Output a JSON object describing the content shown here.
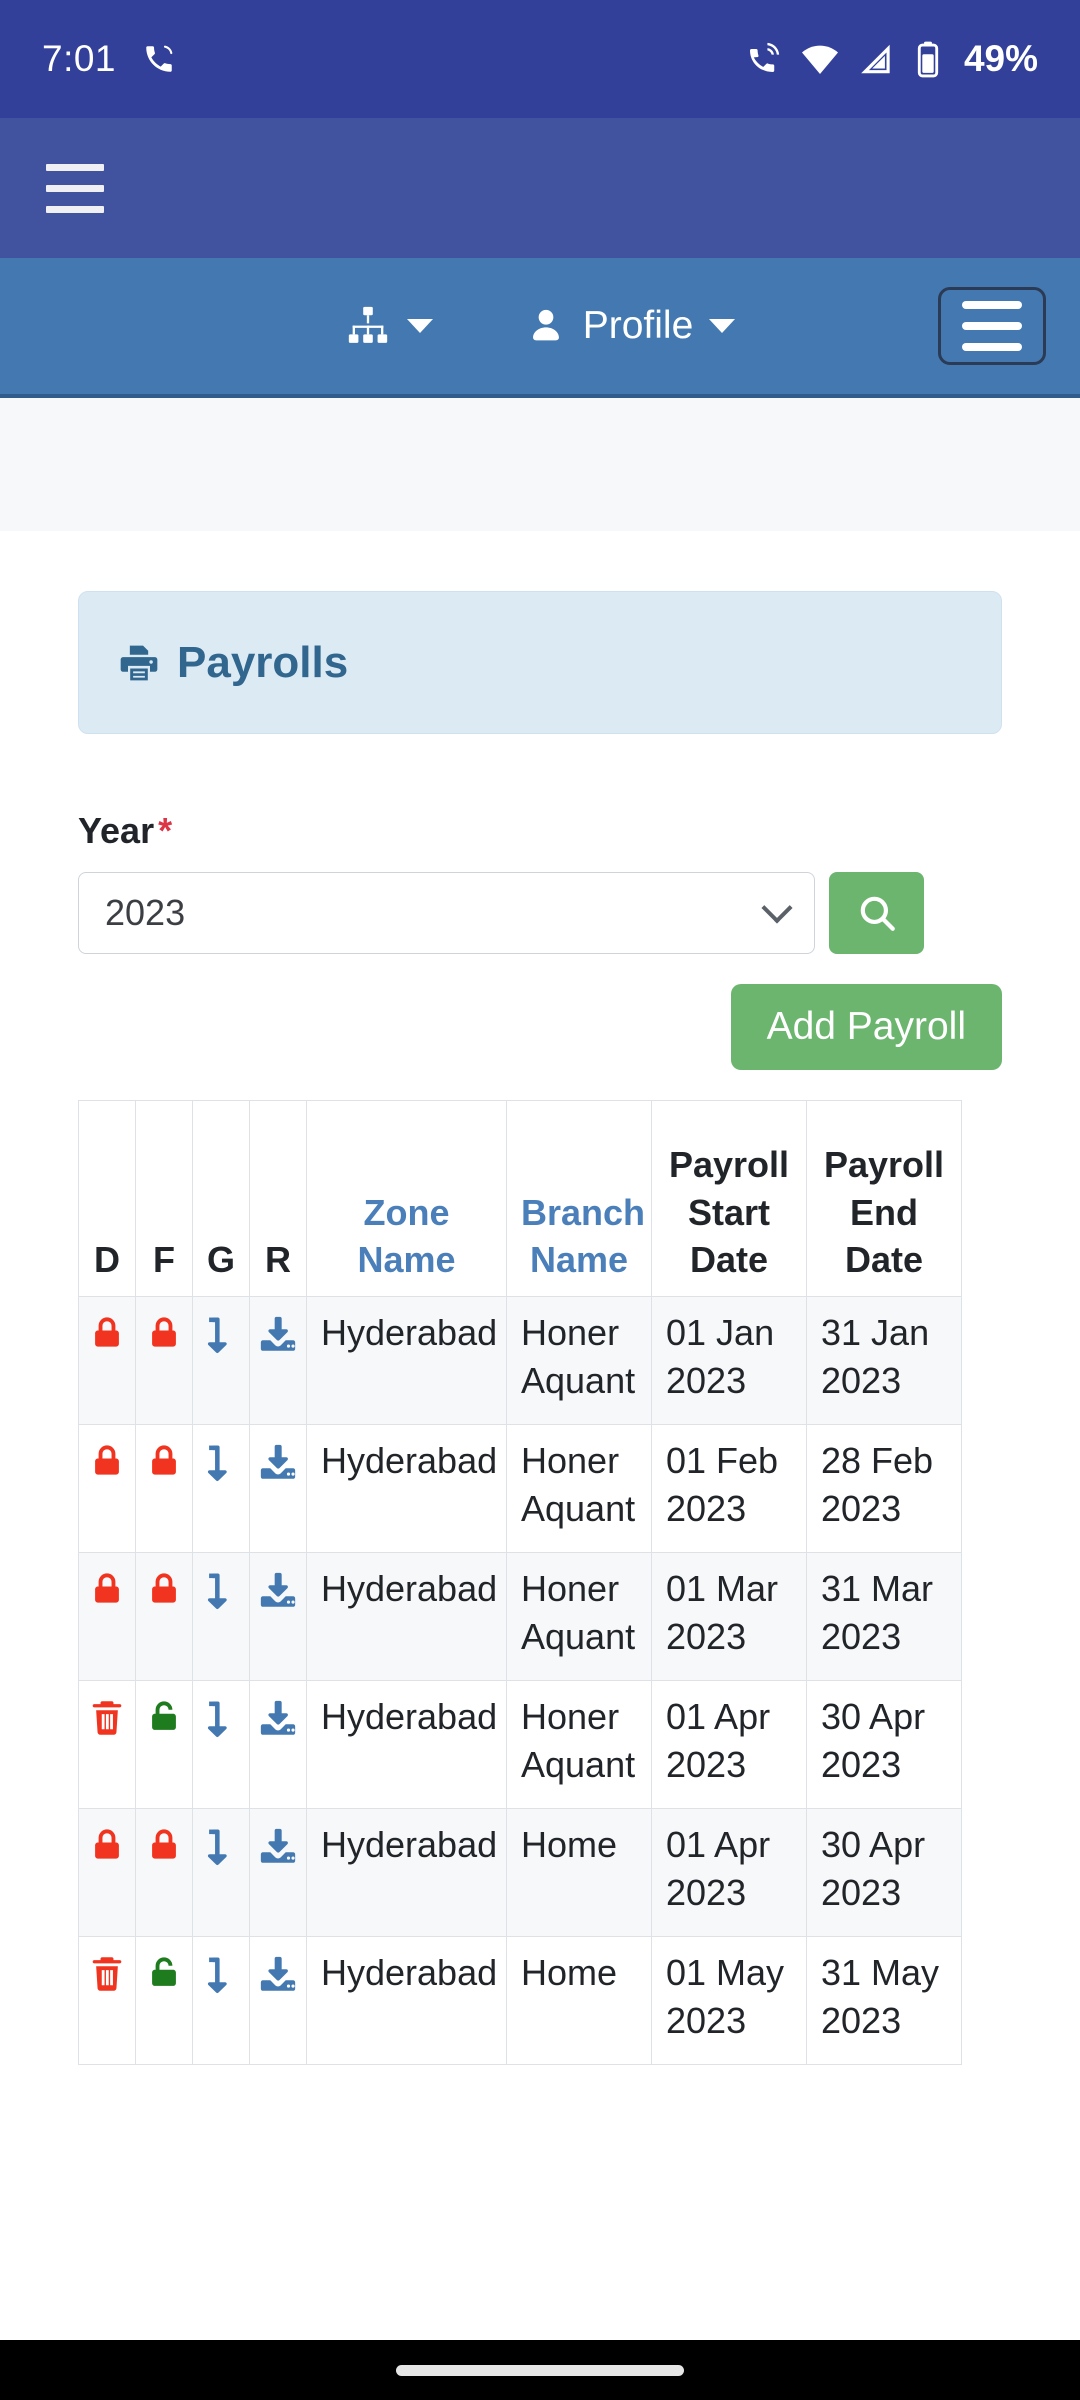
{
  "status_bar": {
    "time": "7:01",
    "battery_percent": "49%",
    "icons": [
      "phone-call-icon",
      "wifi-icon",
      "signal-icon",
      "battery-icon"
    ]
  },
  "browser_chrome": {
    "menu_icon": "hamburger-menu-icon",
    "background": "#41529f"
  },
  "navbar": {
    "background": "#4379b0",
    "sitemap_icon": "sitemap-icon",
    "profile_icon": "user-icon",
    "profile_label": "Profile",
    "toggler_icon": "navbar-toggler-icon"
  },
  "page_header": {
    "icon": "print-icon",
    "title": "Payrolls",
    "background": "#dceaf4",
    "text_color": "#31678e"
  },
  "form": {
    "year_label": "Year",
    "required_marker": "*",
    "year_value": "2023",
    "year_options": [
      "2023"
    ],
    "search_icon": "search-icon",
    "search_button_color": "#6cb56f",
    "add_payroll_label": "Add Payroll"
  },
  "table": {
    "columns": [
      {
        "label": "D",
        "type": "text",
        "link": false
      },
      {
        "label": "F",
        "type": "text",
        "link": false
      },
      {
        "label": "G",
        "type": "text",
        "link": false
      },
      {
        "label": "R",
        "type": "text",
        "link": false
      },
      {
        "label": "Zone Name",
        "type": "text",
        "link": true
      },
      {
        "label": "Branch Name",
        "type": "text",
        "link": true
      },
      {
        "label": "Payroll Start Date",
        "type": "text",
        "link": false
      },
      {
        "label": "Payroll End Date",
        "type": "text",
        "link": false
      }
    ],
    "rows": [
      {
        "d_icon": "lock-closed-icon",
        "d_color": "#f0341f",
        "f_icon": "lock-closed-icon",
        "f_color": "#f0341f",
        "g_icon": "arrow-turn-down-icon",
        "g_color": "#4379b0",
        "r_icon": "download-save-icon",
        "r_color": "#4379b0",
        "zone_name": "Hyderabad",
        "branch_name": "Honer Aquant",
        "start_date": "01 Jan 2023",
        "end_date": "31 Jan 2023"
      },
      {
        "d_icon": "lock-closed-icon",
        "d_color": "#f0341f",
        "f_icon": "lock-closed-icon",
        "f_color": "#f0341f",
        "g_icon": "arrow-turn-down-icon",
        "g_color": "#4379b0",
        "r_icon": "download-save-icon",
        "r_color": "#4379b0",
        "zone_name": "Hyderabad",
        "branch_name": "Honer Aquant",
        "start_date": "01 Feb 2023",
        "end_date": "28 Feb 2023"
      },
      {
        "d_icon": "lock-closed-icon",
        "d_color": "#f0341f",
        "f_icon": "lock-closed-icon",
        "f_color": "#f0341f",
        "g_icon": "arrow-turn-down-icon",
        "g_color": "#4379b0",
        "r_icon": "download-save-icon",
        "r_color": "#4379b0",
        "zone_name": "Hyderabad",
        "branch_name": "Honer Aquant",
        "start_date": "01 Mar 2023",
        "end_date": "31 Mar 2023"
      },
      {
        "d_icon": "trash-icon",
        "d_color": "#f0341f",
        "f_icon": "lock-open-icon",
        "f_color": "#1e7b1e",
        "g_icon": "arrow-turn-down-icon",
        "g_color": "#4379b0",
        "r_icon": "download-save-icon",
        "r_color": "#4379b0",
        "zone_name": "Hyderabad",
        "branch_name": "Honer Aquant",
        "start_date": "01 Apr 2023",
        "end_date": "30 Apr 2023"
      },
      {
        "d_icon": "lock-closed-icon",
        "d_color": "#f0341f",
        "f_icon": "lock-closed-icon",
        "f_color": "#f0341f",
        "g_icon": "arrow-turn-down-icon",
        "g_color": "#4379b0",
        "r_icon": "download-save-icon",
        "r_color": "#4379b0",
        "zone_name": "Hyderabad",
        "branch_name": "Home",
        "start_date": "01 Apr 2023",
        "end_date": "30 Apr 2023"
      },
      {
        "d_icon": "trash-icon",
        "d_color": "#f0341f",
        "f_icon": "lock-open-icon",
        "f_color": "#1e7b1e",
        "g_icon": "arrow-turn-down-icon",
        "g_color": "#4379b0",
        "r_icon": "download-save-icon",
        "r_color": "#4379b0",
        "zone_name": "Hyderabad",
        "branch_name": "Home",
        "start_date": "01 May 2023",
        "end_date": "31 May 2023"
      }
    ]
  },
  "system_nav": {
    "gesture_pill": "home-gesture-pill"
  }
}
